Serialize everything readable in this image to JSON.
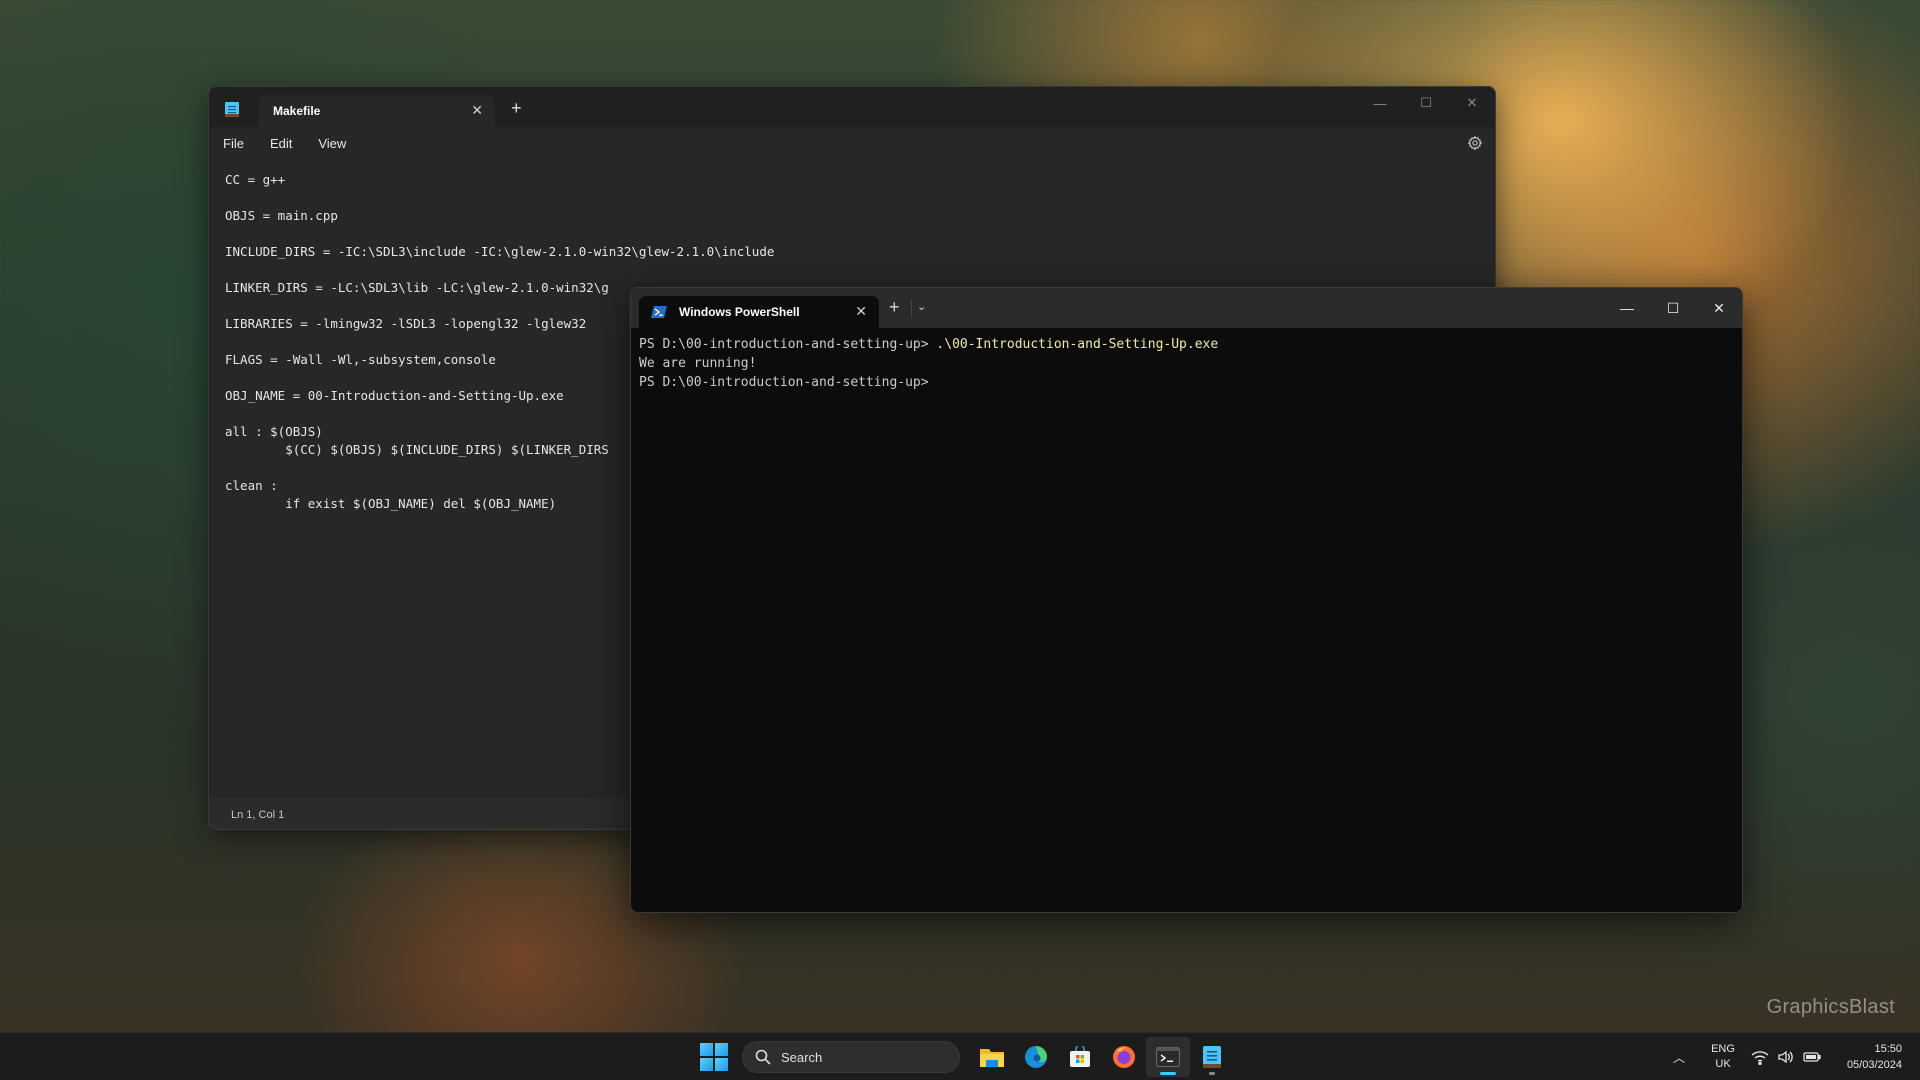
{
  "notepad": {
    "tab_title": "Makefile",
    "menu": [
      "File",
      "Edit",
      "View"
    ],
    "lines": [
      "CC = g++",
      "",
      "OBJS = main.cpp",
      "",
      "INCLUDE_DIRS = -IC:\\SDL3\\include -IC:\\glew-2.1.0-win32\\glew-2.1.0\\include",
      "",
      "LINKER_DIRS = -LC:\\SDL3\\lib -LC:\\glew-2.1.0-win32\\g",
      "",
      "LIBRARIES = -lmingw32 -lSDL3 -lopengl32 -lglew32",
      "",
      "FLAGS = -Wall -Wl,-subsystem,console",
      "",
      "OBJ_NAME = 00-Introduction-and-Setting-Up.exe",
      "",
      "all : $(OBJS)",
      "\t$(CC) $(OBJS) $(INCLUDE_DIRS) $(LINKER_DIRS",
      "",
      "clean :",
      "\tif exist $(OBJ_NAME) del $(OBJ_NAME)"
    ],
    "status": "Ln 1, Col 1"
  },
  "terminal": {
    "tab_title": "Windows PowerShell",
    "prompt1": "PS D:\\00-introduction-and-setting-up> ",
    "command1": ".\\00-Introduction-and-Setting-Up.exe",
    "output1": "We are running!",
    "prompt2": "PS D:\\00-introduction-and-setting-up>"
  },
  "watermark": "GraphicsBlast",
  "taskbar": {
    "search_placeholder": "Search",
    "apps": [
      "file-explorer",
      "edge",
      "microsoft-store",
      "firefox",
      "terminal",
      "notepad"
    ],
    "language_top": "ENG",
    "language_bottom": "UK",
    "time": "15:50",
    "date": "05/03/2024"
  },
  "colors": {
    "accent": "#4cc2ff",
    "command_text": "#f0e8a8"
  }
}
